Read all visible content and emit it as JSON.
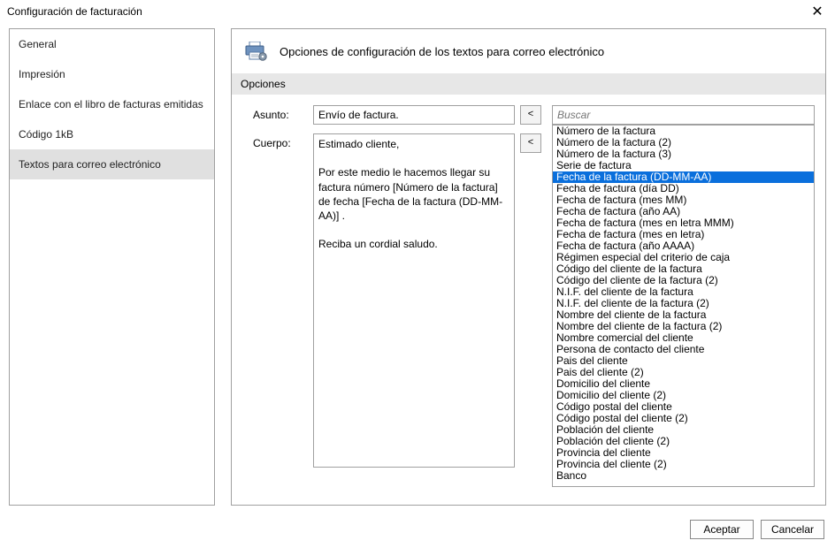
{
  "window": {
    "title": "Configuración de facturación",
    "close_glyph": "✕"
  },
  "sidebar": {
    "items": [
      {
        "label": "General"
      },
      {
        "label": "Impresión"
      },
      {
        "label": "Enlace con el libro de facturas emitidas"
      },
      {
        "label": "Código 1kB"
      },
      {
        "label": "Textos para correo electrónico"
      }
    ],
    "selected_index": 4
  },
  "header": {
    "title": "Opciones de configuración de los textos para correo electrónico"
  },
  "section": {
    "label": "Opciones"
  },
  "form": {
    "asunto_label": "Asunto:",
    "asunto_value": "Envío de factura.",
    "cuerpo_label": "Cuerpo:",
    "cuerpo_value": "Estimado cliente,\n\nPor este medio le hacemos llegar su factura número [Número de la factura] de fecha [Fecha de la factura (DD-MM-AA)] .\n\nReciba un cordial saludo.",
    "insert_btn": "<"
  },
  "search": {
    "placeholder": "Buscar"
  },
  "fields_list": {
    "selected_index": 4,
    "items": [
      "Número de la factura",
      "Número de la factura (2)",
      "Número de la factura (3)",
      "Serie de factura",
      "Fecha de la factura (DD-MM-AA)",
      "Fecha de factura (día DD)",
      "Fecha de factura (mes MM)",
      "Fecha de factura (año AA)",
      "Fecha de factura (mes en letra MMM)",
      "Fecha de factura (mes en letra)",
      "Fecha de factura (año AAAA)",
      "Régimen especial del criterio de caja",
      "Código del cliente de la factura",
      "Código del cliente de la factura (2)",
      "N.I.F. del cliente de la factura",
      "N.I.F. del cliente de la factura (2)",
      "Nombre del cliente de la factura",
      "Nombre del cliente de la factura (2)",
      "Nombre comercial del cliente",
      "Persona de contacto del cliente",
      "Pais del cliente",
      "Pais del cliente (2)",
      "Domicilio del cliente",
      "Domicilio del cliente (2)",
      "Código postal del cliente",
      "Código postal del cliente (2)",
      "Población del cliente",
      "Población del cliente (2)",
      "Provincia del cliente",
      "Provincia del cliente (2)",
      "Banco"
    ]
  },
  "buttons": {
    "accept": "Aceptar",
    "cancel": "Cancelar"
  }
}
